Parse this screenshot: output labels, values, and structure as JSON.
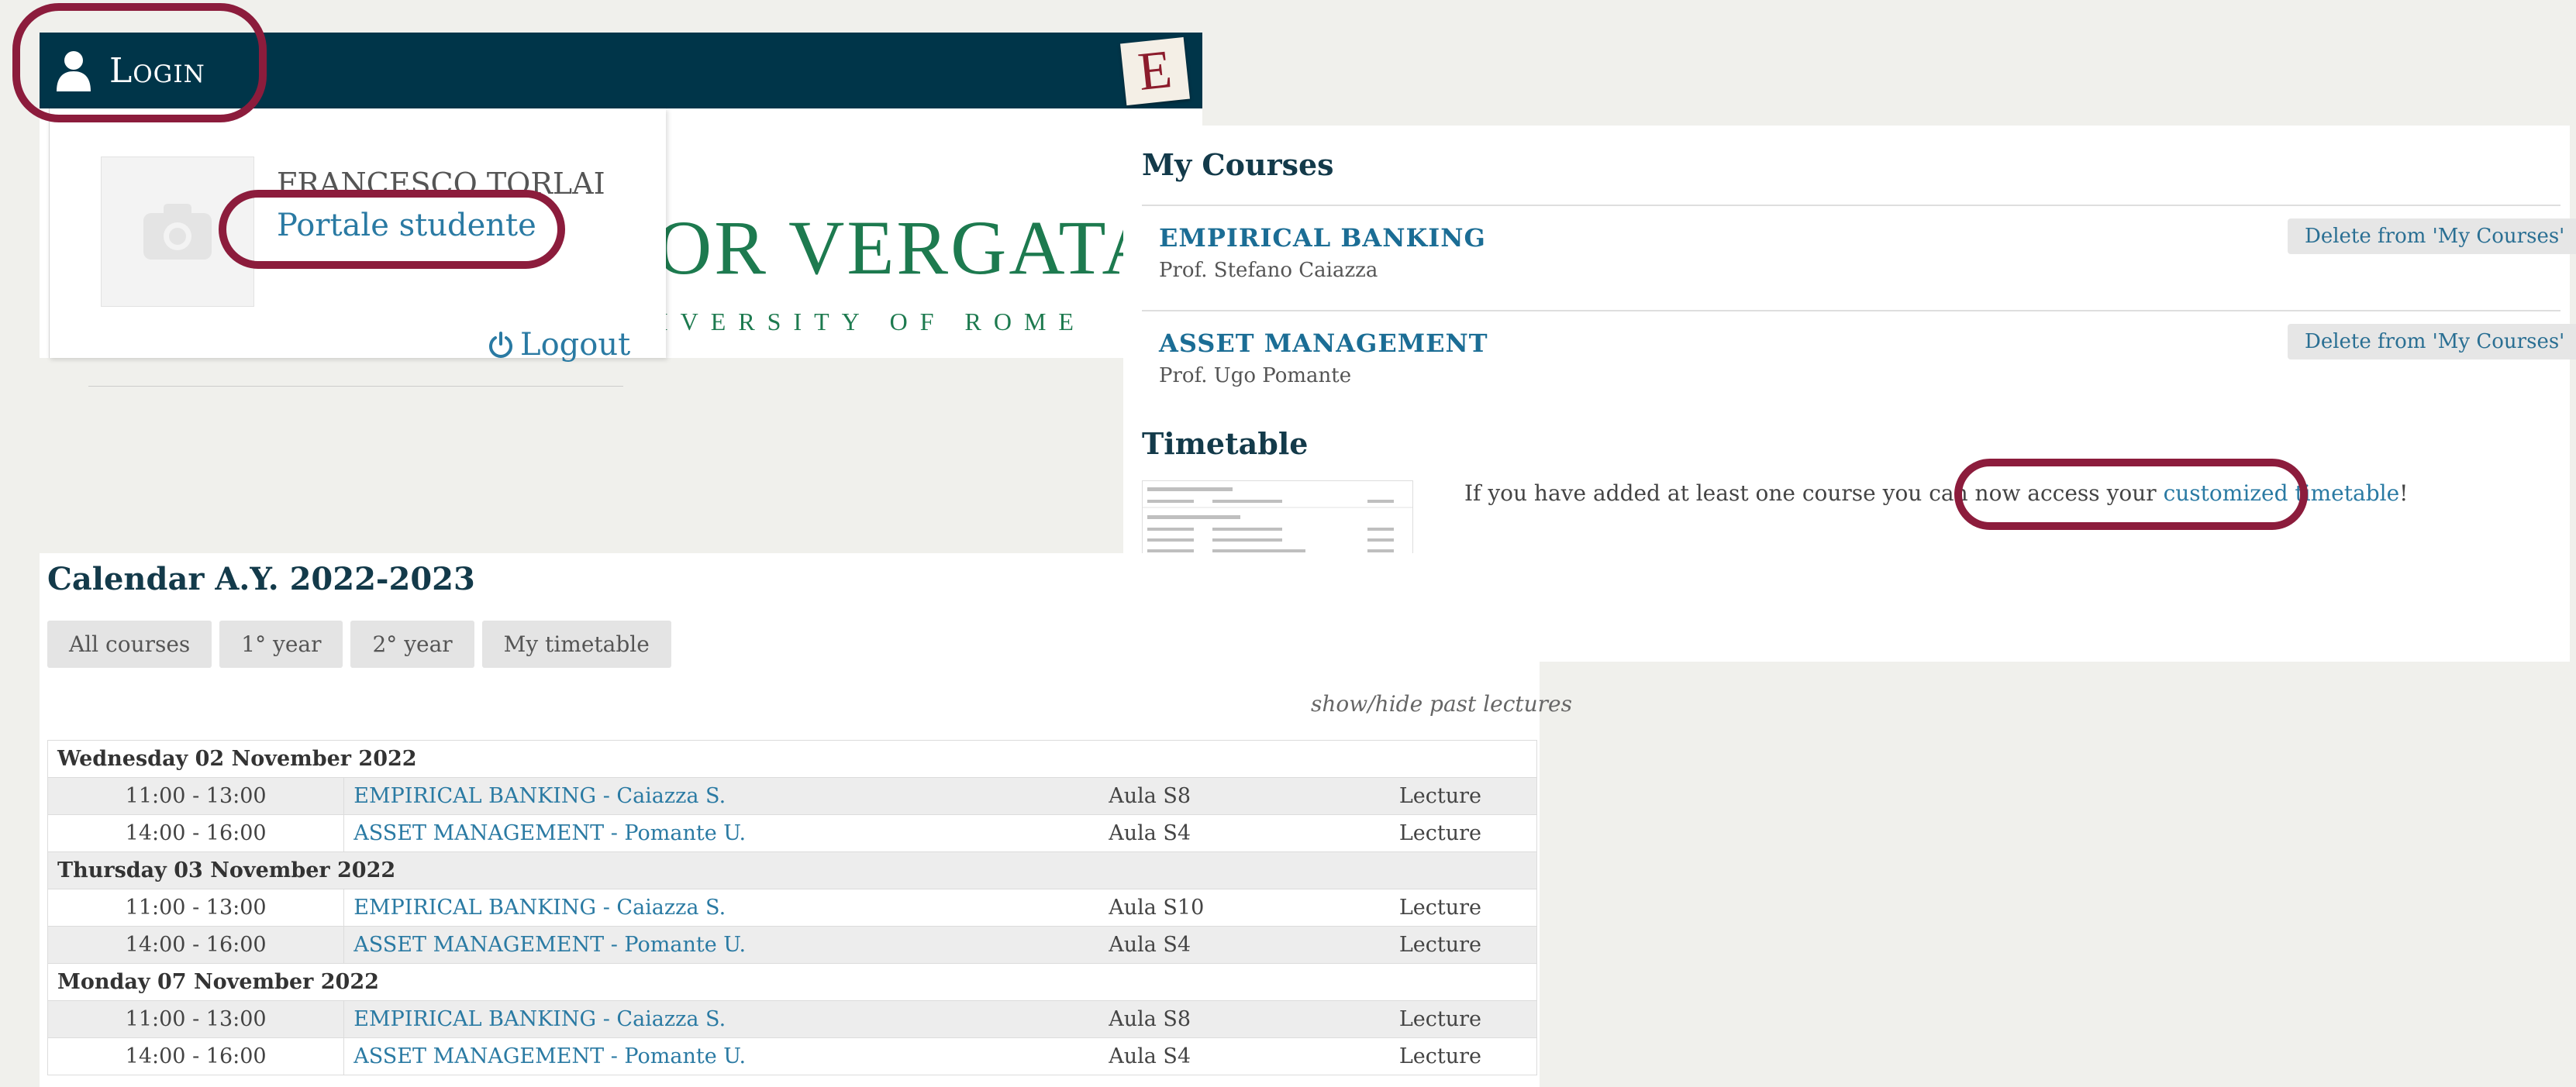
{
  "login": {
    "label": "Login",
    "badge": "E",
    "logo_line1": "OR VERGATA",
    "logo_line2": "IVERSITY OF ROME",
    "user_name": "FRANCESCO TORLAI",
    "portal_link": "Portale studente",
    "logout": "Logout"
  },
  "my_courses": {
    "title": "My Courses",
    "courses": [
      {
        "name": "EMPIRICAL BANKING",
        "prof": "Prof. Stefano Caiazza",
        "delete": "Delete from 'My Courses'"
      },
      {
        "name": "ASSET MANAGEMENT",
        "prof": "Prof. Ugo Pomante",
        "delete": "Delete from 'My Courses'"
      }
    ]
  },
  "timetable": {
    "title": "Timetable",
    "note_prefix": "If you have added at least one course you can now access your ",
    "note_link": "customized timetable",
    "note_suffix": "!"
  },
  "calendar": {
    "title": "Calendar A.Y. 2022-2023",
    "tabs": [
      "All courses",
      "1° year",
      "2° year",
      "My timetable"
    ],
    "toggle_past": "show/hide past lectures",
    "days": [
      {
        "date": "Wednesday 02 November 2022",
        "lectures": [
          {
            "time": "11:00 - 13:00",
            "course": "EMPIRICAL BANKING - Caiazza S.",
            "room": "Aula S8",
            "type": "Lecture"
          },
          {
            "time": "14:00 - 16:00",
            "course": "ASSET MANAGEMENT - Pomante U.",
            "room": "Aula S4",
            "type": "Lecture"
          }
        ]
      },
      {
        "date": "Thursday 03 November 2022",
        "lectures": [
          {
            "time": "11:00 - 13:00",
            "course": "EMPIRICAL BANKING - Caiazza S.",
            "room": "Aula S10",
            "type": "Lecture"
          },
          {
            "time": "14:00 - 16:00",
            "course": "ASSET MANAGEMENT - Pomante U.",
            "room": "Aula S4",
            "type": "Lecture"
          }
        ]
      },
      {
        "date": "Monday 07 November 2022",
        "lectures": [
          {
            "time": "11:00 - 13:00",
            "course": "EMPIRICAL BANKING - Caiazza S.",
            "room": "Aula S8",
            "type": "Lecture"
          },
          {
            "time": "14:00 - 16:00",
            "course": "ASSET MANAGEMENT - Pomante U.",
            "room": "Aula S4",
            "type": "Lecture"
          }
        ]
      }
    ]
  },
  "colors": {
    "header_bar": "#003549",
    "link": "#2a7aa3",
    "highlight_ring": "#8c1c3c",
    "logo_green": "#1d7a4f"
  }
}
